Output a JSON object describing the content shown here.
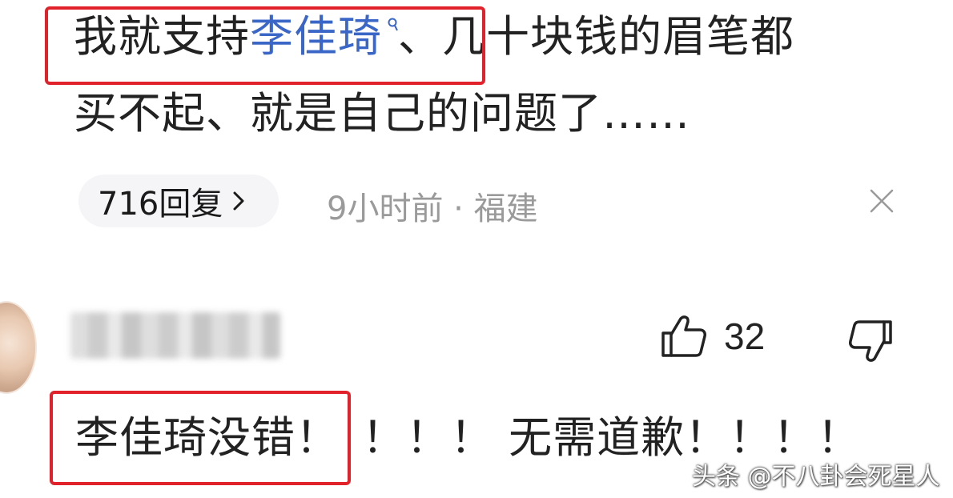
{
  "comment1": {
    "prefix": "我就支持",
    "link_text": "李佳琦",
    "link_icon": "search-icon",
    "line1_rest": "、几十块钱的眉笔都",
    "line2": "买不起、就是自己的问题了……",
    "replies_label": "716回复",
    "time": "9小时前",
    "separator": " · ",
    "location": "福建"
  },
  "comment2": {
    "username": "",
    "like_count": "32",
    "text_highlighted": "李佳琦没错！",
    "text_rest": "！！！ 无需道歉！！！！"
  },
  "watermark": "头条 @不八卦会死星人",
  "colors": {
    "highlight_border": "#e2222a",
    "link": "#3a67c7",
    "meta": "#9a9a9a",
    "pill_bg": "#f5f5f7"
  }
}
